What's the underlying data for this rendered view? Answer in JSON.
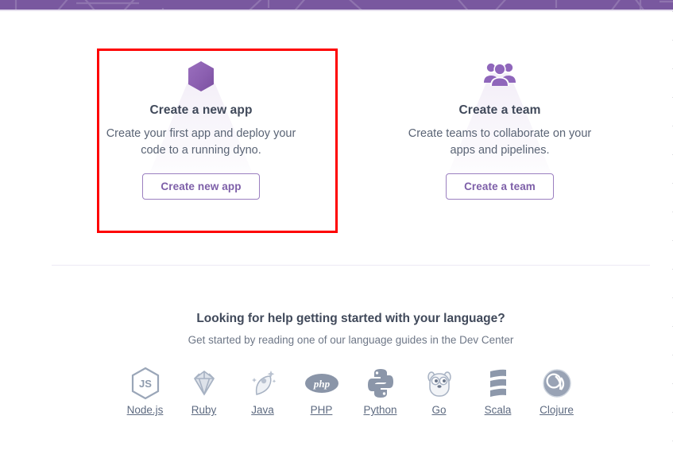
{
  "window": {
    "background_color": "#ffffff",
    "band_color": "#79589f",
    "accent_color": "#7d5fa8",
    "highlight_color": "#fe0000"
  },
  "cards": [
    {
      "icon": "hexagon-icon",
      "title": "Create a new app",
      "description": "Create your first app and deploy your code to a running dyno.",
      "button_label": "Create new app",
      "highlighted": true
    },
    {
      "icon": "team-people-icon",
      "title": "Create a team",
      "description": "Create teams to collaborate on your apps and pipelines.",
      "button_label": "Create a team",
      "highlighted": false
    }
  ],
  "languages_section": {
    "heading": "Looking for help getting started with your language?",
    "subheading": "Get started by reading one of our language guides in the Dev Center",
    "items": [
      {
        "label": "Node.js",
        "icon": "nodejs-icon"
      },
      {
        "label": "Ruby",
        "icon": "ruby-icon"
      },
      {
        "label": "Java",
        "icon": "java-icon"
      },
      {
        "label": "PHP",
        "icon": "php-icon"
      },
      {
        "label": "Python",
        "icon": "python-icon"
      },
      {
        "label": "Go",
        "icon": "go-gopher-icon"
      },
      {
        "label": "Scala",
        "icon": "scala-icon"
      },
      {
        "label": "Clojure",
        "icon": "clojure-icon"
      }
    ]
  }
}
